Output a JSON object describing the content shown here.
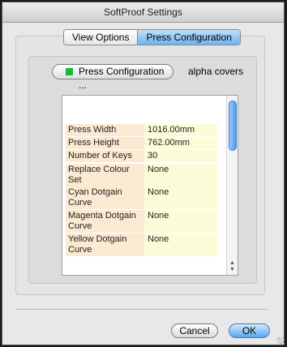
{
  "window": {
    "title": "SoftProof Settings"
  },
  "tabs": [
    {
      "label": "View Options"
    },
    {
      "label": "Press Configuration"
    }
  ],
  "press_button": {
    "label": "Press Configuration ..."
  },
  "alpha_label": "alpha covers",
  "properties": [
    {
      "key": "Press Width",
      "value": "1016.00mm"
    },
    {
      "key": "Press Height",
      "value": "762.00mm"
    },
    {
      "key": "Number of Keys",
      "value": "30"
    },
    {
      "key": "Replace Colour Set",
      "value": "None"
    },
    {
      "key": "Cyan Dotgain Curve",
      "value": "None"
    },
    {
      "key": "Magenta Dotgain Curve",
      "value": "None"
    },
    {
      "key": "Yellow Dotgain Curve",
      "value": "None"
    }
  ],
  "buttons": {
    "cancel": "Cancel",
    "ok": "OK"
  },
  "colors": {
    "accent": "#5aa7ee",
    "swatch": "#19b839",
    "key_bg": "#fbe9d2",
    "value_bg": "#fcfbd7"
  }
}
